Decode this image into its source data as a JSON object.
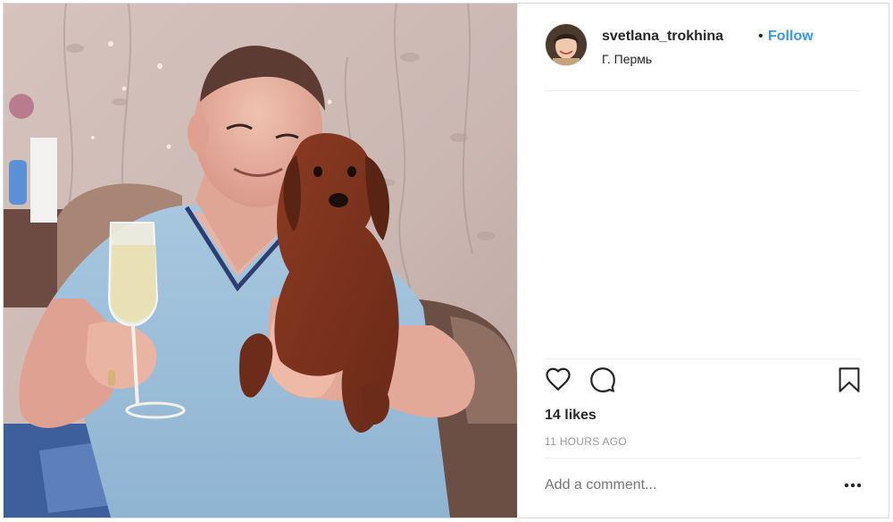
{
  "post": {
    "username": "svetlana_trokhina",
    "separator": "•",
    "follow_label": "Follow",
    "location": "Г. Пермь",
    "likes_text": "14 likes",
    "time_text": "11 HOURS AGO",
    "comment_placeholder": "Add a comment..."
  },
  "icons": {
    "like": "heart-icon",
    "comment": "comment-icon",
    "save": "bookmark-icon",
    "more": "more-options-icon"
  },
  "colors": {
    "follow": "#3897f0",
    "text": "#262626",
    "muted": "#999999",
    "border": "#dbdbdb"
  }
}
